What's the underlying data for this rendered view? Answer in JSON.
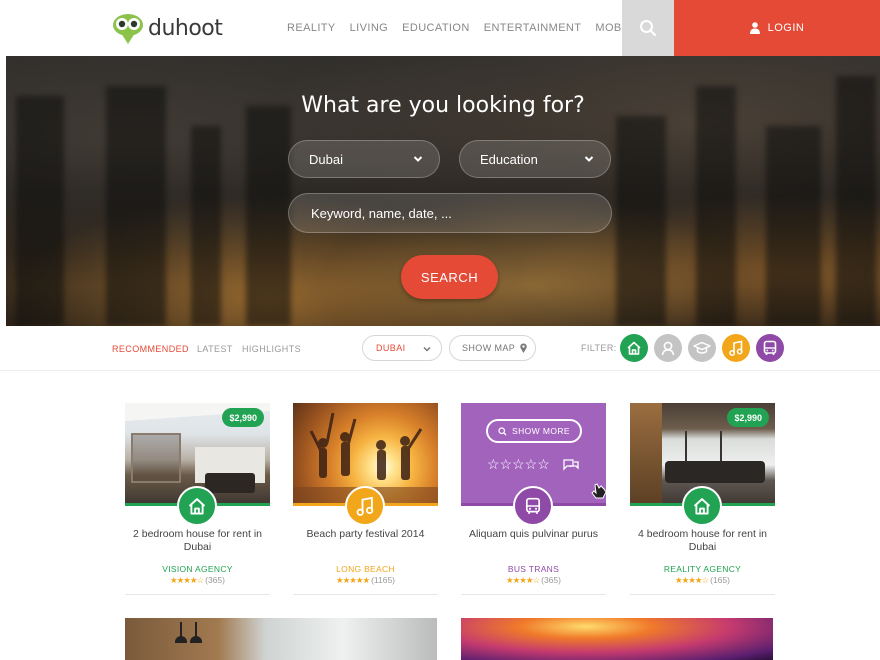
{
  "brand": {
    "name": "duhoot"
  },
  "nav": {
    "items": [
      "REALITY",
      "LIVING",
      "EDUCATION",
      "ENTERTAINMENT",
      "MOBILITY"
    ]
  },
  "header": {
    "login_label": "LOGIN"
  },
  "hero": {
    "title": "What are you looking for?",
    "city_select": "Dubai",
    "category_select": "Education",
    "keyword_placeholder": "Keyword, name, date, ...",
    "search_label": "SEARCH"
  },
  "filterbar": {
    "tabs": [
      "RECOMMENDED",
      "LATEST",
      "HIGHLIGHTS"
    ],
    "location_select": "DUBAI",
    "show_map_label": "SHOW MAP",
    "filter_label": "FILTER:",
    "filter_icons": [
      "home-icon",
      "avatar-icon",
      "graduation-cap-icon",
      "music-note-icon",
      "bus-icon"
    ]
  },
  "cards": [
    {
      "price": "$2,990",
      "title": "2 bedroom house for rent in Dubai",
      "agency": "VISION AGENCY",
      "rating": 4,
      "reviews": "(365)",
      "icon": "home-icon",
      "color": "#21a353"
    },
    {
      "price": "",
      "title": "Beach party festival 2014",
      "agency": "LONG BEACH",
      "rating": 5,
      "reviews": "(1165)",
      "icon": "music-note-icon",
      "color": "#f2a61a"
    },
    {
      "price": "",
      "show_more_label": "SHOW MORE",
      "title": "Aliquam quis pulvinar purus",
      "agency": "BUS TRANS",
      "rating": 4,
      "reviews": "(365)",
      "icon": "bus-icon",
      "color": "#8e4aa6"
    },
    {
      "price": "$2,990",
      "title": "4 bedroom house for rent in Dubai",
      "agency": "REALITY AGENCY",
      "rating": 4,
      "reviews": "(165)",
      "icon": "home-icon",
      "color": "#21a353"
    }
  ],
  "colors": {
    "accent_red": "#e54a36",
    "green": "#21a353",
    "orange": "#f2a61a",
    "purple": "#8e4aa6",
    "gray": "#c4c4c4"
  }
}
